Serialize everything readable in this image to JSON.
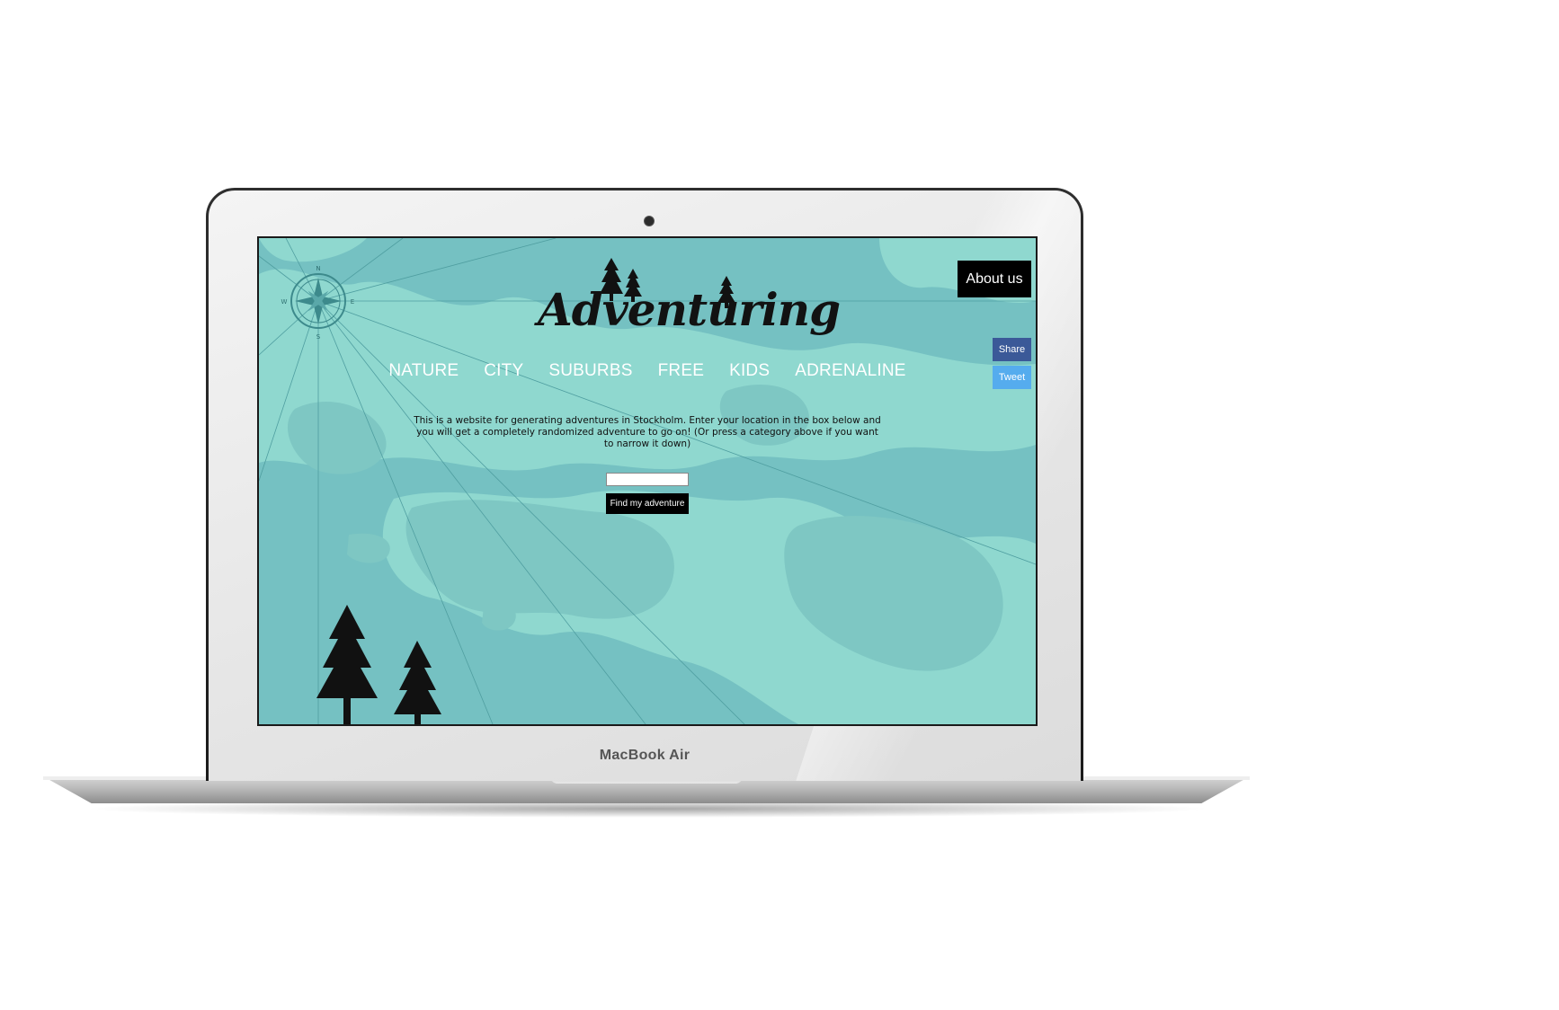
{
  "device": {
    "brand_label": "MacBook Air"
  },
  "site": {
    "logo_text": "Adventuring",
    "about_label": "About us",
    "share_label": "Share",
    "tweet_label": "Tweet",
    "nav": [
      "NATURE",
      "CITY",
      "SUBURBS",
      "FREE",
      "KIDS",
      "ADRENALINE"
    ],
    "intro_text": "This is a website for generating adventures in Stockholm. Enter your location in the box below and you will get a completely randomized adventure to go on! (Or press a category above if you want to narrow it down)",
    "location_input": {
      "value": "",
      "placeholder": ""
    },
    "find_label": "Find my adventure",
    "compass": {
      "n": "N",
      "s": "S",
      "e": "E",
      "w": "W"
    }
  },
  "colors": {
    "map_water": "#75c1c2",
    "map_land": "#8fd8cf",
    "map_shallow": "#7ec7c3",
    "share_blue": "#3b5998",
    "tweet_blue": "#55acee"
  }
}
